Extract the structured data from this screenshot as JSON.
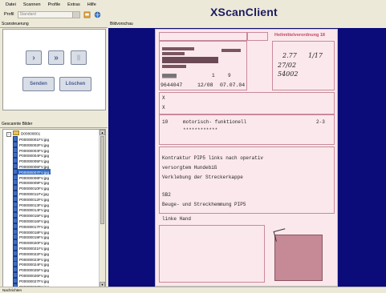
{
  "menu": [
    "Datei",
    "Scannen",
    "Profile",
    "Extras",
    "Hilfe"
  ],
  "toolbar": {
    "profile_label": "Profil",
    "profile_value": "Standard"
  },
  "app_title": "XScanClient",
  "scan_panel": {
    "title": "Scansteuerung",
    "buttons": {
      "play": "›",
      "fast": "»",
      "pause": "||",
      "send": "Senden",
      "delete": "Löschen"
    }
  },
  "tree_panel": {
    "title": "Gescannte Bilder",
    "root": "D00000001",
    "files": [
      "P00000001FV.jpg",
      "P00000002FV.jpg",
      "P00000003FV.jpg",
      "P00000004FV.jpg",
      "P00000005FV.jpg",
      "P00000006FV.jpg",
      "P00000007FV.jpg",
      "P00000008FV.jpg",
      "P00000009FV.jpg",
      "P00000010FV.jpg",
      "P00000011FV.jpg",
      "P00000012FV.jpg",
      "P00000013FV.jpg",
      "P00000014FV.jpg",
      "P00000015FV.jpg",
      "P00000016FV.jpg",
      "P00000017FV.jpg",
      "P00000018FV.jpg",
      "P00000019FV.jpg",
      "P00000020FV.jpg",
      "P00000021FV.jpg",
      "P00000022FV.jpg",
      "P00000023FV.jpg",
      "P00000024FV.jpg",
      "P00000025FV.jpg",
      "P00000026FV.jpg",
      "P00000027FV.jpg",
      "P00000028FV.jpg"
    ],
    "selected_index": 6
  },
  "preview": {
    "title": "Bildvorschau",
    "form_title": "Heilmittelverordnung 18",
    "patient_id": "9644047",
    "period": "12/08",
    "date": "07.07.04",
    "count": "1",
    "count2": "9",
    "hw1": "2.77",
    "hw2": "27/02",
    "hw3": "54002",
    "num": "10",
    "therapy": "motorisch- funktionell",
    "stars": "************",
    "freq": "2-3",
    "diag1": "Kontraktur PIP5 links nach operativ",
    "diag2": "versorgtem Hundebiß",
    "diag3": "Verklebung der Streckerkappe",
    "code": "SB2",
    "goal": "Beuge- und Streckhemmung PIP5",
    "side": "linke Hand"
  },
  "status": "Nachrichten"
}
